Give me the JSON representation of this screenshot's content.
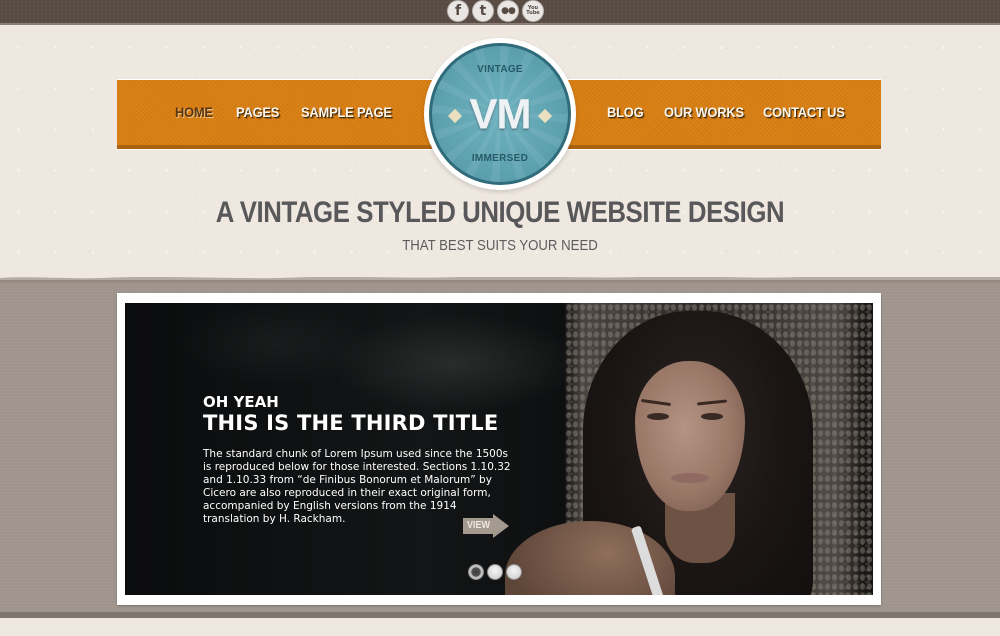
{
  "social": [
    {
      "name": "facebook",
      "glyph": "f"
    },
    {
      "name": "twitter",
      "glyph": "t"
    },
    {
      "name": "flickr",
      "glyph": "●●"
    },
    {
      "name": "youtube",
      "glyph": "You Tube"
    }
  ],
  "nav": {
    "left": [
      {
        "label": "HOME",
        "active": true
      },
      {
        "label": "PAGES",
        "active": false
      },
      {
        "label": "SAMPLE PAGE",
        "active": false
      }
    ],
    "right": [
      {
        "label": "BLOG",
        "active": false
      },
      {
        "label": "OUR WORKS",
        "active": false
      },
      {
        "label": "CONTACT US",
        "active": false
      }
    ]
  },
  "logo": {
    "top_text": "VINTAGE",
    "monogram": "VM",
    "bottom_text": "IMMERSED"
  },
  "hero": {
    "headline": "A VINTAGE STYLED UNIQUE WEBSITE DESIGN",
    "subline": "THAT BEST SUITS YOUR NEED"
  },
  "slider": {
    "kicker": "OH YEAH",
    "title": "THIS IS THE THIRD TITLE",
    "text": "The standard chunk of Lorem Ipsum used since the 1500s is reproduced below for those interested. Sections 1.10.32 and 1.10.33 from “de Finibus Bonorum et Malorum” by Cicero are also reproduced in their exact original form, accompanied by English versions from the 1914 translation by H. Rackham.",
    "view_label": "VIEW",
    "slide_count": 3,
    "active_slide": 1
  },
  "colors": {
    "nav_orange": "#d87e12",
    "logo_teal": "#5ea2b0",
    "top_bar": "#574b44",
    "band": "#9e948c",
    "paper": "#efe8e0"
  }
}
